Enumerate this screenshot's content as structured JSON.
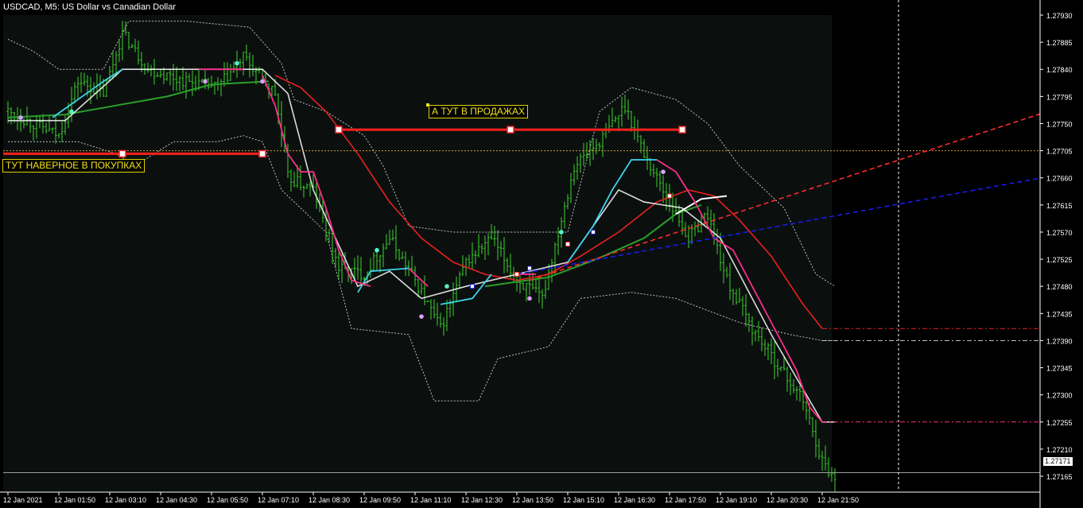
{
  "header": {
    "title": "USDCAD, M5:  US Dollar vs Canadian Dollar"
  },
  "annotations": {
    "sell_text": "А ТУТ В ПРОДАЖАХ",
    "buy_text": "ТУТ НАВЕРНОЕ В ПОКУПКАХ"
  },
  "current_price_label": "1.27171",
  "colors": {
    "background": "#000000",
    "plot_background": "#0b100f",
    "bars": "#3fd22c",
    "white_line": "#ffffff",
    "cyan_line": "#3cd4ef",
    "pink_line": "#ff2d8a",
    "green_ma": "#2aa02a",
    "red_curve": "#e8211f",
    "envelope": "#bfbfbf",
    "red_trend": "#ff2a2a",
    "blue_trend": "#1a1aee",
    "hline_red": "#ff1f1f",
    "hline_orange": "#d79a30",
    "annot_border": "#e6d300",
    "annot_text": "#f2e21a"
  },
  "chart_data": {
    "type": "line",
    "symbol": "USDCAD",
    "timeframe": "M5",
    "ylim": [
      1.2714,
      1.2793
    ],
    "y_ticks": [
      "1.27930",
      "1.27885",
      "1.27840",
      "1.27795",
      "1.27750",
      "1.27705",
      "1.27660",
      "1.27615",
      "1.27570",
      "1.27525",
      "1.27480",
      "1.27435",
      "1.27390",
      "1.27345",
      "1.27300",
      "1.27255",
      "1.27210",
      "1.27165"
    ],
    "x_ticks": [
      "12 Jan 2021",
      "12 Jan 01:50",
      "12 Jan 03:10",
      "12 Jan 04:30",
      "12 Jan 05:50",
      "12 Jan 07:10",
      "12 Jan 08:30",
      "12 Jan 09:50",
      "12 Jan 11:10",
      "12 Jan 12:30",
      "12 Jan 13:50",
      "12 Jan 15:10",
      "12 Jan 16:30",
      "12 Jan 17:50",
      "12 Jan 19:10",
      "12 Jan 20:30",
      "12 Jan 21:50"
    ],
    "x_tick_index": [
      0,
      16,
      32,
      48,
      64,
      80,
      96,
      112,
      128,
      144,
      160,
      176,
      192,
      208,
      224,
      240,
      256
    ],
    "bar_count": 261,
    "close_anchors": [
      [
        0,
        1.2777
      ],
      [
        8,
        1.2775
      ],
      [
        16,
        1.2773
      ],
      [
        22,
        1.2782
      ],
      [
        30,
        1.278
      ],
      [
        36,
        1.279
      ],
      [
        44,
        1.2784
      ],
      [
        56,
        1.2782
      ],
      [
        66,
        1.2781
      ],
      [
        74,
        1.2786
      ],
      [
        84,
        1.278
      ],
      [
        88,
        1.2766
      ],
      [
        96,
        1.2764
      ],
      [
        104,
        1.2751
      ],
      [
        112,
        1.275
      ],
      [
        120,
        1.2756
      ],
      [
        128,
        1.2749
      ],
      [
        136,
        1.2741
      ],
      [
        144,
        1.2752
      ],
      [
        152,
        1.2756
      ],
      [
        160,
        1.2749
      ],
      [
        168,
        1.2746
      ],
      [
        178,
        1.2768
      ],
      [
        186,
        1.2772
      ],
      [
        194,
        1.2778
      ],
      [
        200,
        1.277
      ],
      [
        208,
        1.2762
      ],
      [
        214,
        1.2756
      ],
      [
        220,
        1.276
      ],
      [
        226,
        1.2749
      ],
      [
        234,
        1.2741
      ],
      [
        242,
        1.2735
      ],
      [
        250,
        1.2729
      ],
      [
        256,
        1.2719
      ],
      [
        260,
        1.2716
      ]
    ],
    "white_line": [
      [
        0,
        1.27755
      ],
      [
        18,
        1.27755
      ],
      [
        36,
        1.2784
      ],
      [
        58,
        1.2784
      ],
      [
        80,
        1.2784
      ],
      [
        88,
        1.278
      ],
      [
        96,
        1.2764
      ],
      [
        110,
        1.2748
      ],
      [
        120,
        1.27505
      ],
      [
        130,
        1.2746
      ],
      [
        144,
        1.2748
      ],
      [
        160,
        1.275
      ],
      [
        176,
        1.2752
      ],
      [
        192,
        1.2764
      ],
      [
        200,
        1.2762
      ],
      [
        212,
        1.2761
      ],
      [
        224,
        1.2756
      ],
      [
        240,
        1.274
      ],
      [
        256,
        1.27255
      ],
      [
        260,
        1.27255
      ]
    ],
    "cyan_segments": [
      [
        [
          14,
          1.2776
        ],
        [
          22,
          1.2779
        ],
        [
          30,
          1.2782
        ],
        [
          36,
          1.2784
        ]
      ],
      [
        [
          110,
          1.2747
        ],
        [
          114,
          1.27505
        ],
        [
          126,
          1.2751
        ]
      ],
      [
        [
          136,
          1.2745
        ],
        [
          146,
          1.2746
        ],
        [
          152,
          1.275
        ]
      ],
      [
        [
          176,
          1.2752
        ],
        [
          184,
          1.2758
        ],
        [
          190,
          1.2764
        ],
        [
          196,
          1.2769
        ],
        [
          204,
          1.2769
        ]
      ]
    ],
    "pink_segments": [
      [
        [
          60,
          1.2784
        ],
        [
          74,
          1.2784
        ]
      ],
      [
        [
          80,
          1.2783
        ],
        [
          84,
          1.2778
        ],
        [
          88,
          1.277
        ],
        [
          92,
          1.2767
        ],
        [
          96,
          1.2767
        ],
        [
          100,
          1.2761
        ],
        [
          104,
          1.2754
        ],
        [
          108,
          1.2749
        ],
        [
          114,
          1.2748
        ]
      ],
      [
        [
          126,
          1.2751
        ],
        [
          132,
          1.2748
        ]
      ],
      [
        [
          160,
          1.275
        ],
        [
          166,
          1.275
        ]
      ],
      [
        [
          204,
          1.2769
        ],
        [
          210,
          1.2767
        ],
        [
          216,
          1.2762
        ],
        [
          222,
          1.2756
        ],
        [
          228,
          1.2754
        ],
        [
          232,
          1.275
        ],
        [
          238,
          1.2744
        ],
        [
          244,
          1.2738
        ],
        [
          248,
          1.2734
        ],
        [
          252,
          1.2728
        ],
        [
          256,
          1.27255
        ]
      ]
    ],
    "green_ma": [
      [
        0,
        1.2776
      ],
      [
        18,
        1.27765
      ],
      [
        34,
        1.2778
      ],
      [
        50,
        1.27795
      ],
      [
        64,
        1.27815
      ],
      [
        82,
        1.2782
      ]
    ],
    "green_ma2": [
      [
        150,
        1.2748
      ],
      [
        170,
        1.27495
      ],
      [
        185,
        1.27525
      ],
      [
        200,
        1.2756
      ],
      [
        210,
        1.276
      ],
      [
        218,
        1.27615
      ]
    ],
    "white_ma_tail": [
      [
        210,
        1.276
      ],
      [
        218,
        1.27625
      ],
      [
        226,
        1.2763
      ]
    ],
    "red_curve": [
      [
        84,
        1.2783
      ],
      [
        92,
        1.2781
      ],
      [
        100,
        1.2777
      ],
      [
        110,
        1.277
      ],
      [
        120,
        1.2762
      ],
      [
        130,
        1.2756
      ],
      [
        140,
        1.2752
      ],
      [
        150,
        1.275
      ],
      [
        160,
        1.2749
      ],
      [
        170,
        1.275
      ],
      [
        180,
        1.2753
      ],
      [
        192,
        1.2757
      ],
      [
        204,
        1.2762
      ],
      [
        214,
        1.2764
      ],
      [
        222,
        1.2763
      ],
      [
        230,
        1.2759
      ],
      [
        240,
        1.2753
      ],
      [
        250,
        1.2745
      ],
      [
        256,
        1.2741
      ]
    ],
    "envelope_upper": [
      [
        0,
        1.2789
      ],
      [
        8,
        1.2787
      ],
      [
        16,
        1.2784
      ],
      [
        30,
        1.2784
      ],
      [
        38,
        1.2792
      ],
      [
        56,
        1.2792
      ],
      [
        76,
        1.2791
      ],
      [
        86,
        1.2785
      ],
      [
        90,
        1.2779
      ],
      [
        100,
        1.2777
      ],
      [
        112,
        1.2773
      ],
      [
        118,
        1.2768
      ],
      [
        126,
        1.2758
      ],
      [
        140,
        1.2757
      ],
      [
        156,
        1.2757
      ],
      [
        176,
        1.2757
      ],
      [
        186,
        1.2777
      ],
      [
        196,
        1.2781
      ],
      [
        210,
        1.2779
      ],
      [
        220,
        1.2775
      ],
      [
        230,
        1.2768
      ],
      [
        244,
        1.2761
      ],
      [
        254,
        1.275
      ],
      [
        260,
        1.2748
      ]
    ],
    "envelope_lower": [
      [
        0,
        1.2772
      ],
      [
        12,
        1.2772
      ],
      [
        22,
        1.2772
      ],
      [
        34,
        1.277
      ],
      [
        40,
        1.2768
      ],
      [
        52,
        1.2772
      ],
      [
        66,
        1.2772
      ],
      [
        74,
        1.2773
      ],
      [
        80,
        1.2772
      ],
      [
        86,
        1.2764
      ],
      [
        100,
        1.2757
      ],
      [
        108,
        1.2741
      ],
      [
        126,
        1.274
      ],
      [
        134,
        1.2729
      ],
      [
        148,
        1.2729
      ],
      [
        154,
        1.2736
      ],
      [
        170,
        1.2738
      ],
      [
        180,
        1.2746
      ],
      [
        196,
        1.2747
      ],
      [
        210,
        1.2746
      ],
      [
        230,
        1.2742
      ],
      [
        246,
        1.274
      ],
      [
        256,
        1.2739
      ],
      [
        260,
        1.2739
      ]
    ],
    "dots": [
      [
        4,
        1.2776,
        "#d9a0ff"
      ],
      [
        20,
        1.2777,
        "#55f2c8"
      ],
      [
        62,
        1.2782,
        "#d9a0ff"
      ],
      [
        72,
        1.2785,
        "#55f2c8"
      ],
      [
        80,
        1.2782,
        "#d9a0ff"
      ],
      [
        116,
        1.2754,
        "#55f2c8"
      ],
      [
        130,
        1.2743,
        "#d9a0ff"
      ],
      [
        138,
        1.2748,
        "#55f2c8"
      ],
      [
        164,
        1.2746,
        "#d9a0ff"
      ],
      [
        174,
        1.2757,
        "#55f2c8"
      ],
      [
        206,
        1.2767,
        "#d9a0ff"
      ]
    ],
    "trend_markers": [
      [
        146,
        1.2748
      ],
      [
        160,
        1.275
      ],
      [
        164,
        1.2751
      ],
      [
        176,
        1.2755
      ],
      [
        184,
        1.2757
      ],
      [
        208,
        1.2763
      ]
    ],
    "hline_sell": {
      "y": 1.2774,
      "from_index": 104,
      "to_index": 212
    },
    "hline_buy": {
      "y": 1.277,
      "from_index": 0,
      "to_index": 80
    },
    "hline_orange": 1.27705,
    "hline_current": 1.27171,
    "hline_red_end": 1.2741,
    "hline_white_end": 1.2739,
    "hline_pink_end": 1.27255,
    "red_trend": {
      "from": [
        164,
        1.2749
      ],
      "to_slope": 1.72e-05
    },
    "blue_trend": {
      "from": [
        160,
        1.275
      ],
      "to_slope": 9.7e-06
    }
  }
}
